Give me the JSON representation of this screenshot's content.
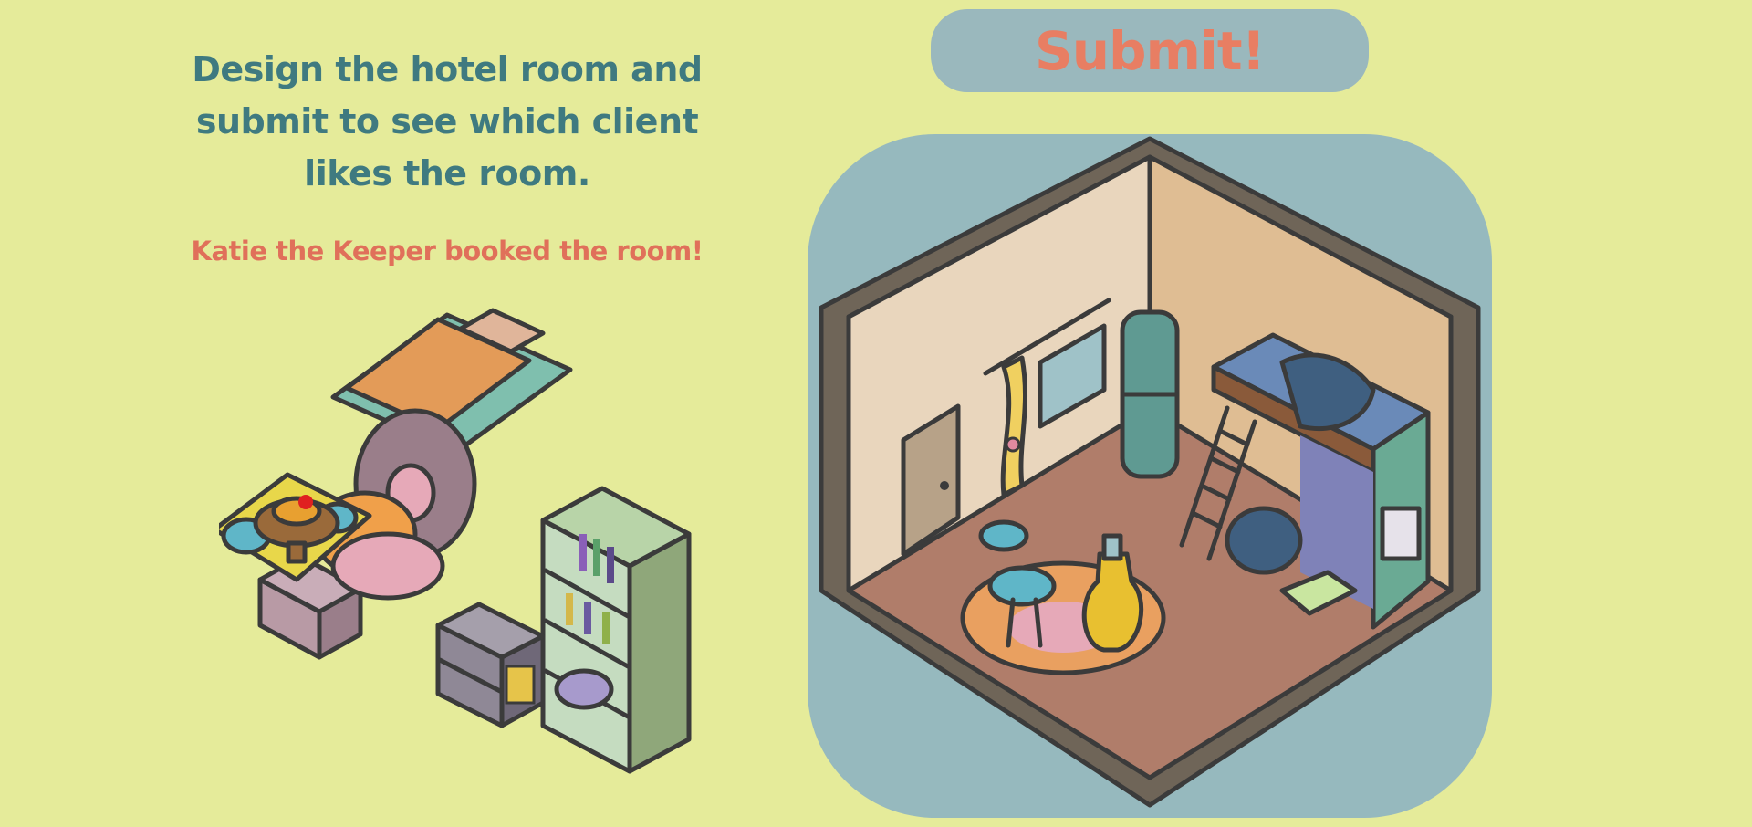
{
  "instructions": {
    "line1": "Design the hotel room and",
    "line2": "submit to see which client",
    "line3": "likes the room."
  },
  "booking_message": "Katie the Keeper booked the room!",
  "submit_label": "Submit!",
  "colors": {
    "background": "#e5eb9a",
    "instruction_text": "#3f7a80",
    "booking_text": "#e0705a",
    "submit_bg": "#9ab8bd",
    "submit_text": "#e87e63",
    "room_panel": "#96b9be"
  },
  "furniture_pile": [
    "bed-item",
    "armchair-item",
    "table-item",
    "fruit-bowl-item",
    "stool-item",
    "nightstand-item",
    "dresser-item",
    "bookshelf-item"
  ],
  "room_items": [
    "door",
    "window",
    "curtain",
    "tall-cabinet",
    "round-rug",
    "side-table",
    "yellow-vase",
    "loft-bed",
    "ladder",
    "bean-bag",
    "floor-cushion",
    "wall-calendar"
  ]
}
